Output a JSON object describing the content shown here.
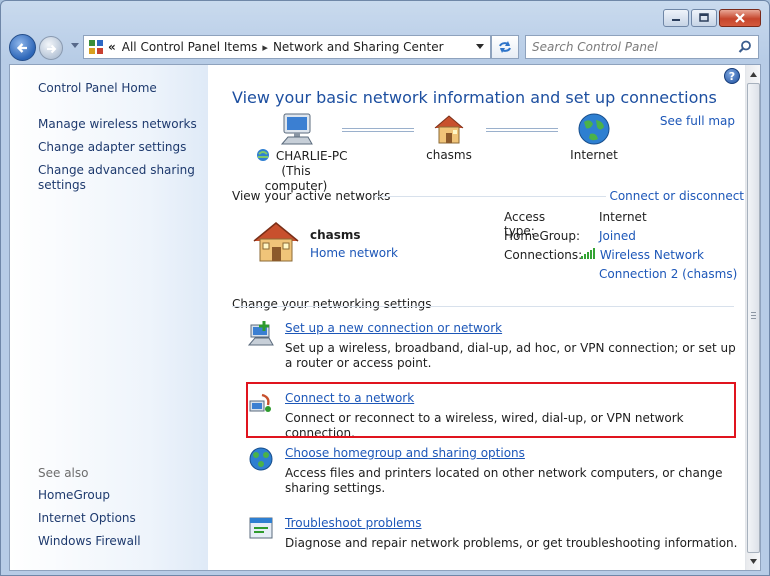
{
  "window": {
    "caption_buttons": [
      "minimize",
      "maximize",
      "close"
    ]
  },
  "address_bar": {
    "overflow_chevron": "«",
    "crumbs": [
      "All Control Panel Items",
      "Network and Sharing Center"
    ],
    "separator": "▸"
  },
  "search": {
    "placeholder": "Search Control Panel"
  },
  "sidebar": {
    "home": "Control Panel Home",
    "links": [
      "Manage wireless networks",
      "Change adapter settings",
      "Change advanced sharing settings"
    ],
    "see_also_title": "See also",
    "see_also": [
      "HomeGroup",
      "Internet Options",
      "Windows Firewall"
    ]
  },
  "main": {
    "help": "?",
    "title": "View your basic network information and set up connections",
    "see_full_map": "See full map",
    "map": {
      "computer_name": "CHARLIE-PC",
      "computer_sub": "(This computer)",
      "network": "chasms",
      "internet": "Internet"
    },
    "active_networks": {
      "heading": "View your active networks",
      "connect_link": "Connect or disconnect",
      "network_name": "chasms",
      "network_type": "Home network",
      "access_type_label": "Access type:",
      "access_type_value": "Internet",
      "homegroup_label": "HomeGroup:",
      "homegroup_value": "Joined",
      "connections_label": "Connections:",
      "connection_line1": "Wireless Network",
      "connection_line2": "Connection 2 (chasms)"
    },
    "settings_heading": "Change your networking settings",
    "tasks": [
      {
        "link": "Set up a new connection or network",
        "desc": "Set up a wireless, broadband, dial-up, ad hoc, or VPN connection; or set up a router or access point."
      },
      {
        "link": "Connect to a network",
        "desc": "Connect or reconnect to a wireless, wired, dial-up, or VPN network connection."
      },
      {
        "link": "Choose homegroup and sharing options",
        "desc": "Access files and printers located on other network computers, or change sharing settings."
      },
      {
        "link": "Troubleshoot problems",
        "desc": "Diagnose and repair network problems, or get troubleshooting information."
      }
    ]
  },
  "colors": {
    "link": "#1d57b8",
    "title": "#1d4fa0",
    "highlight": "#e0141e"
  }
}
